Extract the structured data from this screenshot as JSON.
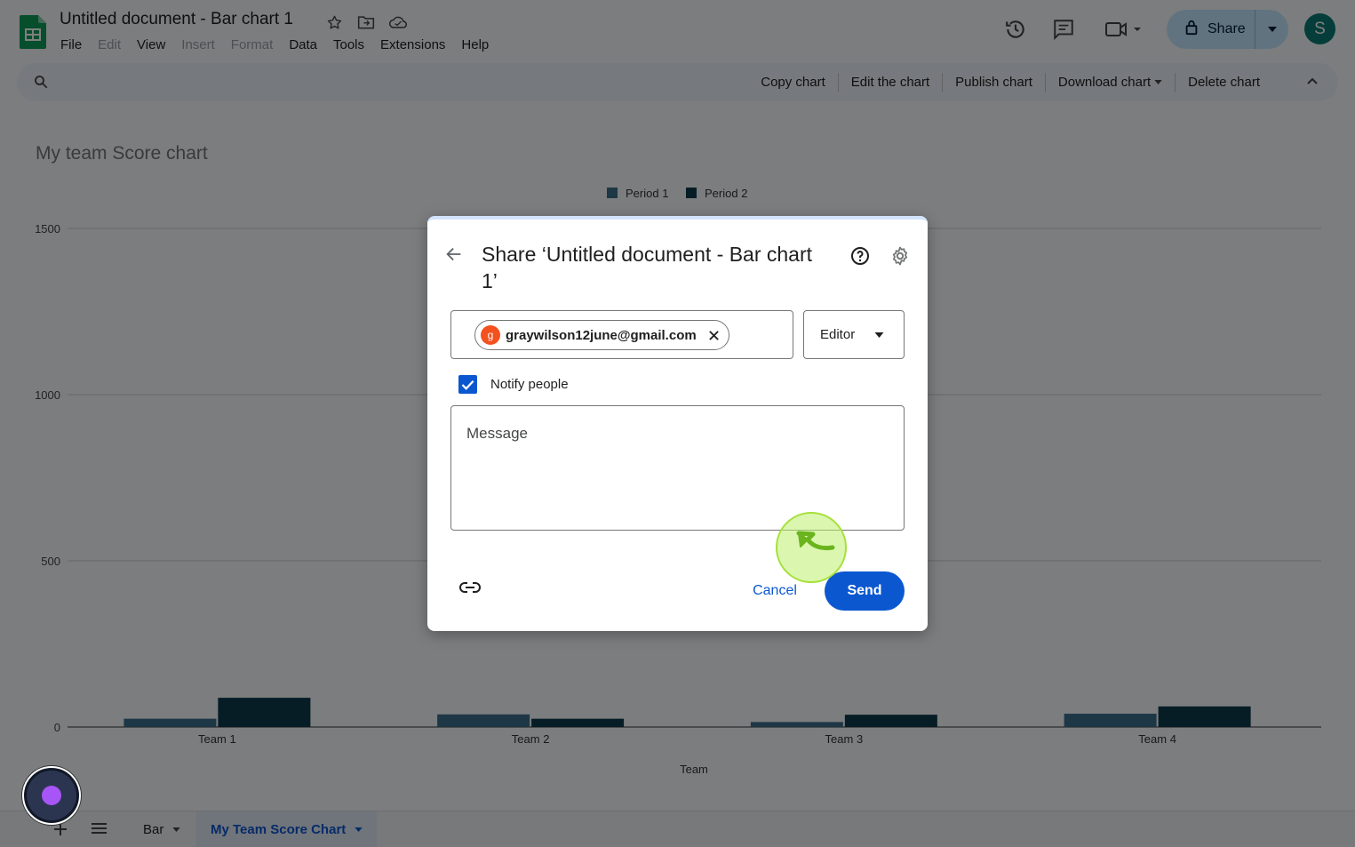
{
  "app": {
    "doc_title": "Untitled document - Bar chart 1",
    "menu": [
      {
        "label": "File",
        "enabled": true
      },
      {
        "label": "Edit",
        "enabled": false
      },
      {
        "label": "View",
        "enabled": true
      },
      {
        "label": "Insert",
        "enabled": false
      },
      {
        "label": "Format",
        "enabled": false
      },
      {
        "label": "Data",
        "enabled": true
      },
      {
        "label": "Tools",
        "enabled": true
      },
      {
        "label": "Extensions",
        "enabled": true
      },
      {
        "label": "Help",
        "enabled": true
      }
    ],
    "share_label": "Share",
    "avatar_initial": "S"
  },
  "toolbar": {
    "copy_chart": "Copy chart",
    "edit_chart": "Edit the chart",
    "publish_chart": "Publish chart",
    "download_chart": "Download chart",
    "delete_chart": "Delete chart"
  },
  "chart_data": {
    "type": "bar",
    "title": "My team Score chart",
    "xlabel": "Team",
    "ylabel": "",
    "categories": [
      "Team 1",
      "Team 2",
      "Team 3",
      "Team 4"
    ],
    "series": [
      {
        "name": "Period 1",
        "color": "#3d6f8c",
        "values": [
          25,
          38,
          15,
          40
        ]
      },
      {
        "name": "Period 2",
        "color": "#0c3b4d",
        "values": [
          88,
          25,
          37,
          62
        ]
      }
    ],
    "ylim": [
      0,
      1500
    ],
    "yticks": [
      0,
      500,
      1000,
      1500
    ],
    "legend": "top",
    "grid": true
  },
  "bottom": {
    "sheets": [
      {
        "label": "Bar",
        "active": false
      },
      {
        "label": "My Team Score Chart",
        "active": true
      }
    ]
  },
  "dialog": {
    "title": "Share ‘Untitled document - Bar chart 1’",
    "recipient_initial": "g",
    "recipient_email": "graywilson12june@gmail.com",
    "role": "Editor",
    "notify_label": "Notify people",
    "notify_checked": true,
    "message_placeholder": "Message",
    "cancel_label": "Cancel",
    "send_label": "Send"
  },
  "colors": {
    "accent": "#0b57d0",
    "share_button": "#c2e7ff",
    "sheets_green": "#0f9d58",
    "cursor_highlight": "#a6e03a"
  }
}
